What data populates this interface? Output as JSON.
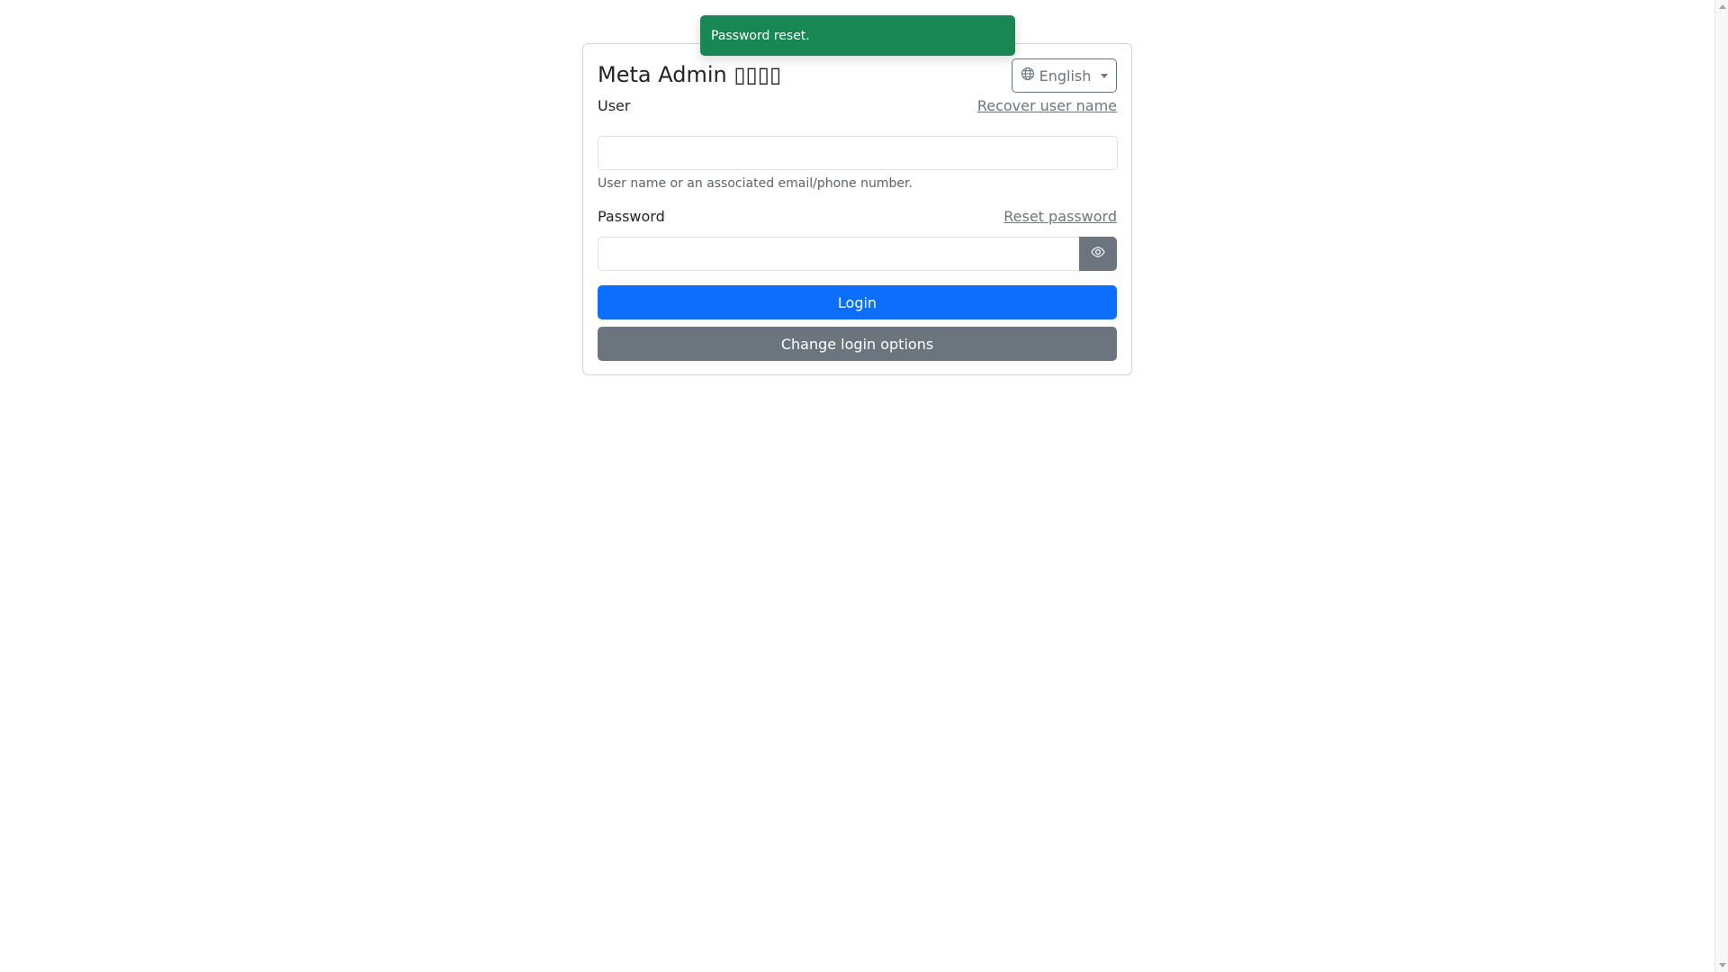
{
  "page": {
    "title": "Meta Admin ▯▯▯▯"
  },
  "language": {
    "selected": "English",
    "icon": "globe-icon"
  },
  "form": {
    "user": {
      "label": "User",
      "link": "Recover user name",
      "value": "",
      "help": "User name or an associated email/phone number."
    },
    "password": {
      "label": "Password",
      "link": "Reset password",
      "value": "",
      "toggle_icon": "eye-icon"
    },
    "login_label": "Login",
    "change_options_label": "Change login options"
  },
  "toast": {
    "message": "Password reset."
  },
  "colors": {
    "primary": "#0d6efd",
    "secondary": "#6c757d",
    "success": "#198754"
  }
}
